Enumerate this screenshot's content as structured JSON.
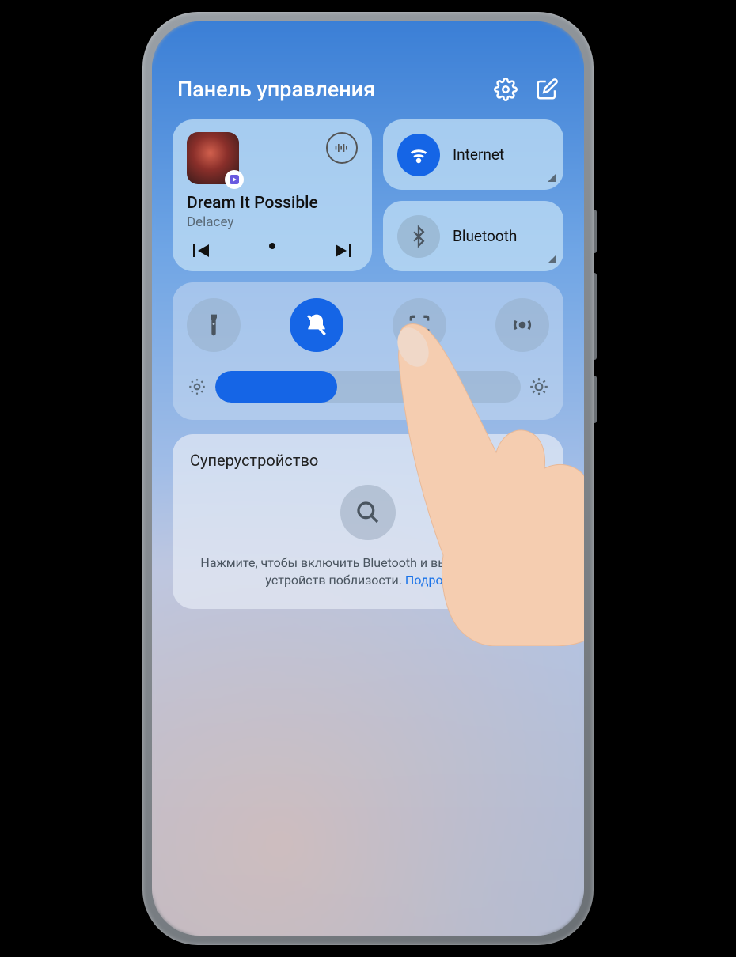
{
  "header": {
    "title": "Панель управления",
    "settings_icon": "settings",
    "edit_icon": "edit"
  },
  "music": {
    "song_title": "Dream It Possible",
    "artist": "Delacey",
    "prev_icon": "skip-previous",
    "play_icon": "play",
    "next_icon": "skip-next",
    "output_icon": "audio-output"
  },
  "connectivity": {
    "internet": {
      "label": "Internet",
      "active": true
    },
    "bluetooth": {
      "label": "Bluetooth",
      "active": false
    }
  },
  "toggles": {
    "brightness_percent": 40,
    "items": [
      {
        "name": "flashlight",
        "active": false
      },
      {
        "name": "mute-notifications",
        "active": true
      },
      {
        "name": "screenshot",
        "active": false
      },
      {
        "name": "nfc",
        "active": false
      }
    ]
  },
  "super_device": {
    "title": "Суперустройство",
    "hint_main": "Нажмите, чтобы включить Bluetooth и выполнить поиск устройств поблизости. ",
    "hint_link": "Подробнее"
  },
  "colors": {
    "accent": "#1565e6",
    "link": "#1a73e8"
  }
}
